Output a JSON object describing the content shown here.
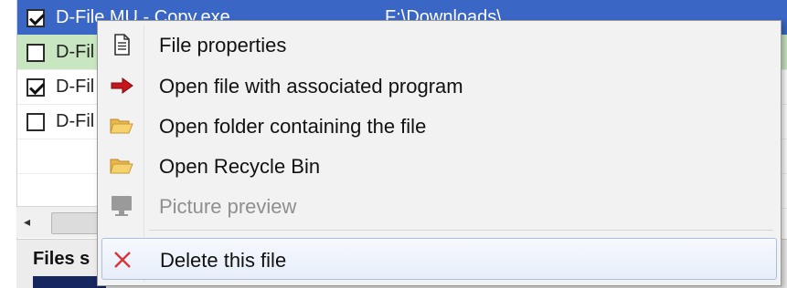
{
  "list": {
    "rows": [
      {
        "name": "D-File MU - Copy.exe",
        "path": "F:\\Downloads\\",
        "checked": true,
        "state": "selected"
      },
      {
        "name": "D-Fil",
        "path": "",
        "checked": false,
        "state": "highlight"
      },
      {
        "name": "D-Fil",
        "path": "",
        "checked": true,
        "state": "normal"
      },
      {
        "name": "D-Fil",
        "path": "",
        "checked": false,
        "state": "normal"
      }
    ],
    "scroll_left_glyph": "◂"
  },
  "status": {
    "files_label": "Files s"
  },
  "context_menu": {
    "items": [
      {
        "label": "File properties",
        "icon": "document-icon",
        "enabled": true
      },
      {
        "label": "Open file with associated program",
        "icon": "red-arrow-icon",
        "enabled": true
      },
      {
        "label": "Open folder containing the file",
        "icon": "folder-icon",
        "enabled": true
      },
      {
        "label": "Open Recycle Bin",
        "icon": "folder-icon",
        "enabled": true
      },
      {
        "label": "Picture preview",
        "icon": "monitor-icon",
        "enabled": false
      },
      {
        "label": "Delete this file",
        "icon": "red-x-icon",
        "enabled": true,
        "hovered": true
      }
    ]
  },
  "colors": {
    "selection_blue": "#3a66c6",
    "highlight_green": "#c8e6c0",
    "menu_bg": "#f2f2f2",
    "hover_border": "#a9bfe0"
  }
}
